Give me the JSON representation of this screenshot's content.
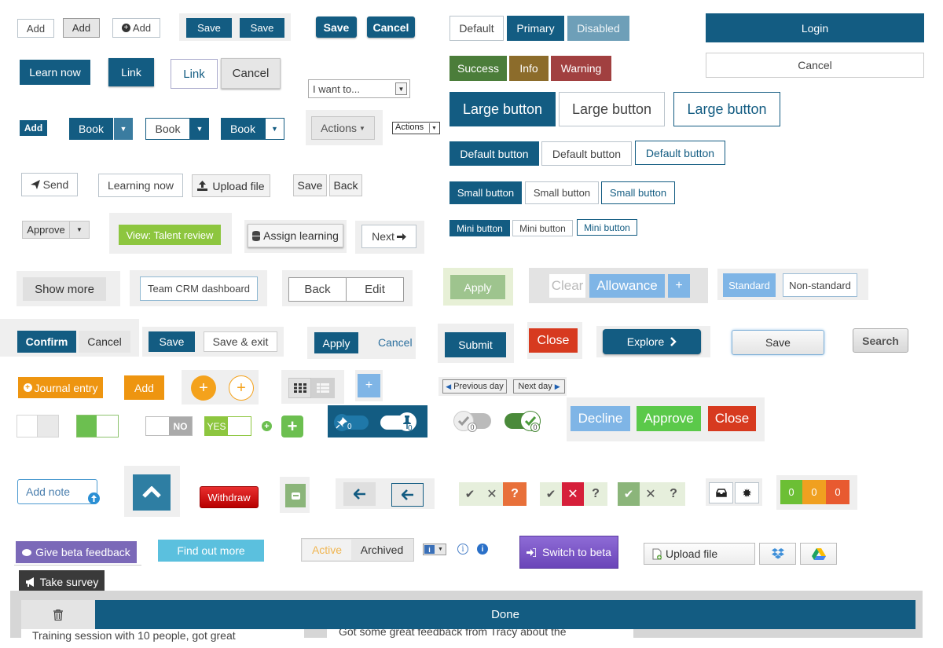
{
  "colors": {
    "primary": "#135c82",
    "success": "#4b7d3a",
    "info": "#8c6c2b",
    "warning": "#a14040",
    "danger": "#d73a1f",
    "orange": "#ee9510",
    "green_light": "#8dc63f",
    "purple": "#7b69b8",
    "light_blue": "#7fb5e6",
    "aqua": "#5bc0de"
  },
  "row1": {
    "add1": "Add",
    "add2": "Add",
    "add3": "Add",
    "save1": "Save",
    "save2": "Save",
    "save3": "Save",
    "cancel": "Cancel",
    "default": "Default",
    "primary": "Primary",
    "disabled": "Disabled",
    "login": "Login",
    "cancel2": "Cancel"
  },
  "row2": {
    "learn_now": "Learn now",
    "link1": "Link",
    "link2": "Link",
    "cancel": "Cancel",
    "i_want_to": "I want to...",
    "success": "Success",
    "info": "Info",
    "warning": "Warning"
  },
  "sizes": {
    "large": "Large button",
    "default": "Default button",
    "small": "Small button",
    "mini": "Mini button"
  },
  "row3": {
    "add": "Add",
    "book1": "Book",
    "book2": "Book",
    "book3": "Book",
    "actions1": "Actions",
    "actions2": "Actions"
  },
  "row4": {
    "send": "Send",
    "learning_now": "Learning now",
    "upload_file": "Upload file",
    "save": "Save",
    "back": "Back"
  },
  "row5": {
    "approve": "Approve",
    "talent": "View:  Talent review",
    "assign": "Assign learning",
    "next": "Next"
  },
  "row6": {
    "show_more": "Show more",
    "team_crm": "Team CRM dashboard",
    "back": "Back",
    "edit": "Edit",
    "apply": "Apply",
    "clear": "Clear",
    "allowance": "Allowance",
    "plus": "+",
    "standard": "Standard",
    "non_standard": "Non-standard"
  },
  "row7": {
    "confirm": "Confirm",
    "cancel": "Cancel",
    "save": "Save",
    "save_exit": "Save & exit",
    "apply": "Apply",
    "cancel_link": "Cancel",
    "submit": "Submit",
    "close": "Close",
    "explore": "Explore",
    "save2": "Save",
    "search": "Search"
  },
  "row8": {
    "journal": "Journal entry",
    "add": "Add",
    "plus": "+",
    "prev_day": "Previous day",
    "next_day": "Next day"
  },
  "row9": {
    "no": "NO",
    "yes": "YES",
    "badge0a": "0",
    "badge0b": "0",
    "badge0c": "0",
    "badge0d": "0",
    "decline": "Decline",
    "approve": "Approve",
    "close": "Close"
  },
  "row10": {
    "add_note": "Add note",
    "withdraw": "Withdraw",
    "q1": "?",
    "q2": "?",
    "q3": "?",
    "score1": "0",
    "score2": "0",
    "score3": "0"
  },
  "row11": {
    "beta_feedback": "Give beta feedback",
    "find_out": "Find out more",
    "active": "Active",
    "archived": "Archived",
    "switch_beta": "Switch to beta",
    "upload_file": "Upload file",
    "take_survey": "Take survey"
  },
  "footer": {
    "done": "Done",
    "text_left": "Training session with 10 people, got great",
    "text_right": "Got some great feedback from Tracy about the"
  }
}
